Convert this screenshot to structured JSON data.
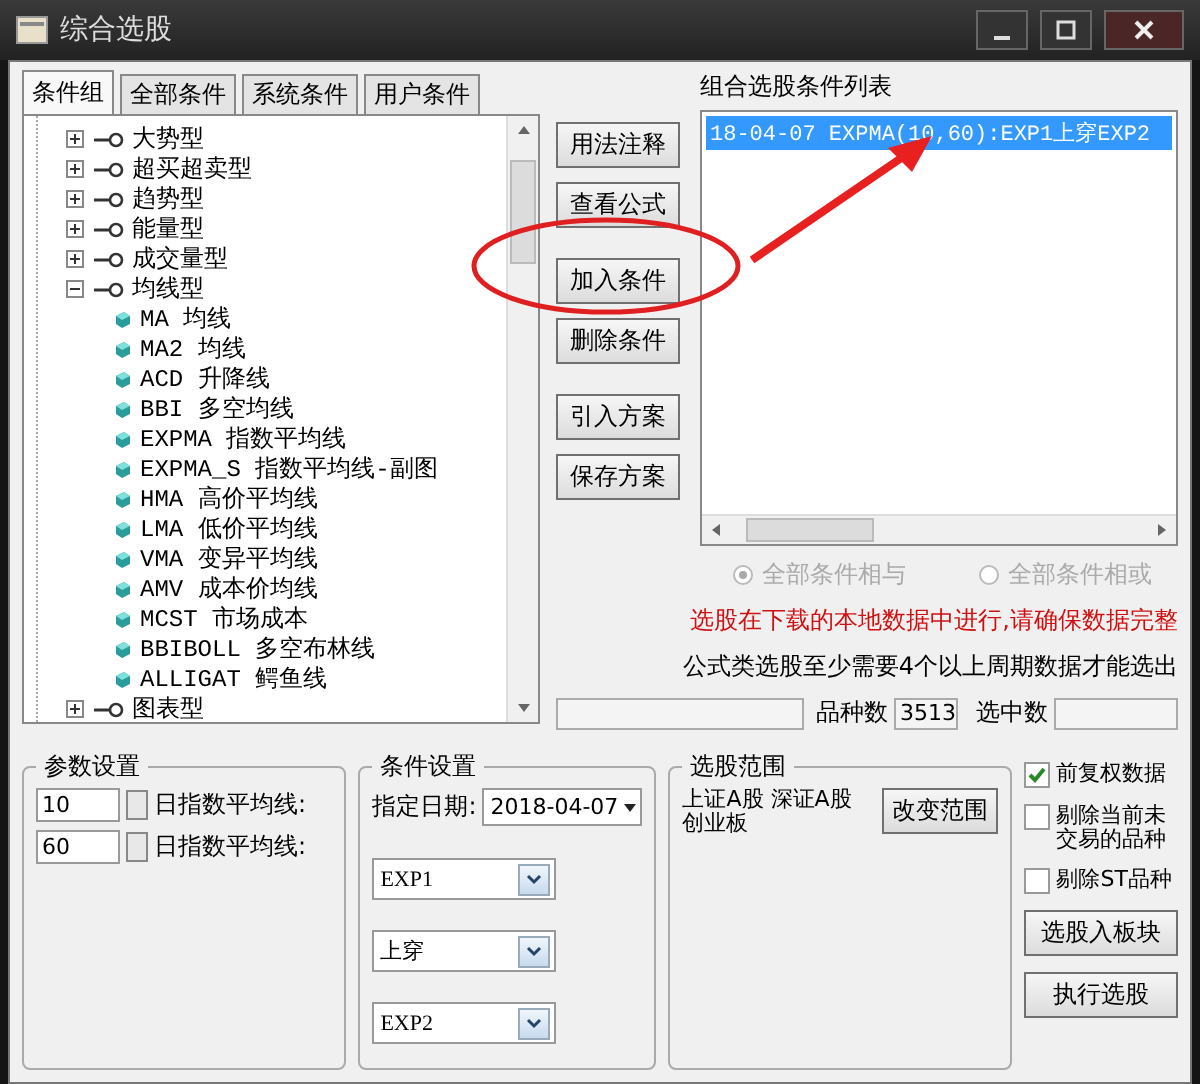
{
  "window": {
    "title": "综合选股"
  },
  "tabs": [
    {
      "label": "条件组",
      "selected": true
    },
    {
      "label": "全部条件",
      "selected": false
    },
    {
      "label": "系统条件",
      "selected": false
    },
    {
      "label": "用户条件",
      "selected": false
    }
  ],
  "tree": [
    {
      "label": "大势型",
      "kind": "group",
      "expanded": false
    },
    {
      "label": "超买超卖型",
      "kind": "group",
      "expanded": false
    },
    {
      "label": "趋势型",
      "kind": "group",
      "expanded": false
    },
    {
      "label": "能量型",
      "kind": "group",
      "expanded": false
    },
    {
      "label": "成交量型",
      "kind": "group",
      "expanded": false
    },
    {
      "label": "均线型",
      "kind": "group",
      "expanded": true,
      "children": [
        {
          "label": "MA 均线",
          "kind": "formula"
        },
        {
          "label": "MA2 均线",
          "kind": "formula"
        },
        {
          "label": "ACD 升降线",
          "kind": "formula"
        },
        {
          "label": "BBI 多空均线",
          "kind": "formula"
        },
        {
          "label": "EXPMA 指数平均线",
          "kind": "formula"
        },
        {
          "label": "EXPMA_S 指数平均线-副图",
          "kind": "formula"
        },
        {
          "label": "HMA 高价平均线",
          "kind": "formula"
        },
        {
          "label": "LMA 低价平均线",
          "kind": "formula"
        },
        {
          "label": "VMA 变异平均线",
          "kind": "formula"
        },
        {
          "label": "AMV 成本价均线",
          "kind": "formula"
        },
        {
          "label": "MCST 市场成本",
          "kind": "formula"
        },
        {
          "label": "BBIBOLL 多空布林线",
          "kind": "formula"
        },
        {
          "label": "ALLIGAT 鳄鱼线",
          "kind": "formula"
        }
      ]
    },
    {
      "label": "图表型",
      "kind": "group",
      "expanded": false
    }
  ],
  "action_buttons": [
    "用法注释",
    "查看公式",
    "加入条件",
    "删除条件",
    "引入方案",
    "保存方案"
  ],
  "condition_list": {
    "title": "组合选股条件列表",
    "items": [
      {
        "text": "18-04-07 EXPMA(10,60):EXP1上穿EXP2",
        "selected": true
      }
    ]
  },
  "logic": [
    {
      "label": "全部条件相与",
      "selected": true,
      "disabled": true
    },
    {
      "label": "全部条件相或",
      "selected": false,
      "disabled": true
    }
  ],
  "notes": [
    {
      "text": "选股在下载的本地数据中进行,请确保数据完整",
      "kind": "warning"
    },
    {
      "text": "公式类选股至少需要4个以上周期数据才能选出",
      "kind": "info"
    }
  ],
  "stats": {
    "count_label": "品种数",
    "count": "3513",
    "selected_label": "选中数"
  },
  "params": {
    "title": "参数设置",
    "rows": [
      {
        "value": "10",
        "label": "日指数平均线:"
      },
      {
        "value": "60",
        "label": "日指数平均线:"
      }
    ]
  },
  "condition": {
    "title": "条件设置",
    "date_label": "指定日期:",
    "date": "2018-04-07",
    "selects": [
      "EXP1",
      "上穿",
      "EXP2"
    ]
  },
  "range": {
    "title": "选股范围",
    "lines": [
      "上证A股 深证A股",
      "创业板"
    ],
    "button": "改变范围"
  },
  "options": [
    {
      "label": "前复权数据",
      "checked": true
    },
    {
      "label": "剔除当前未交易的品种",
      "checked": false
    },
    {
      "label": "剔除ST品种",
      "checked": false
    }
  ],
  "bottom_buttons": [
    "选股入板块",
    "执行选股"
  ]
}
